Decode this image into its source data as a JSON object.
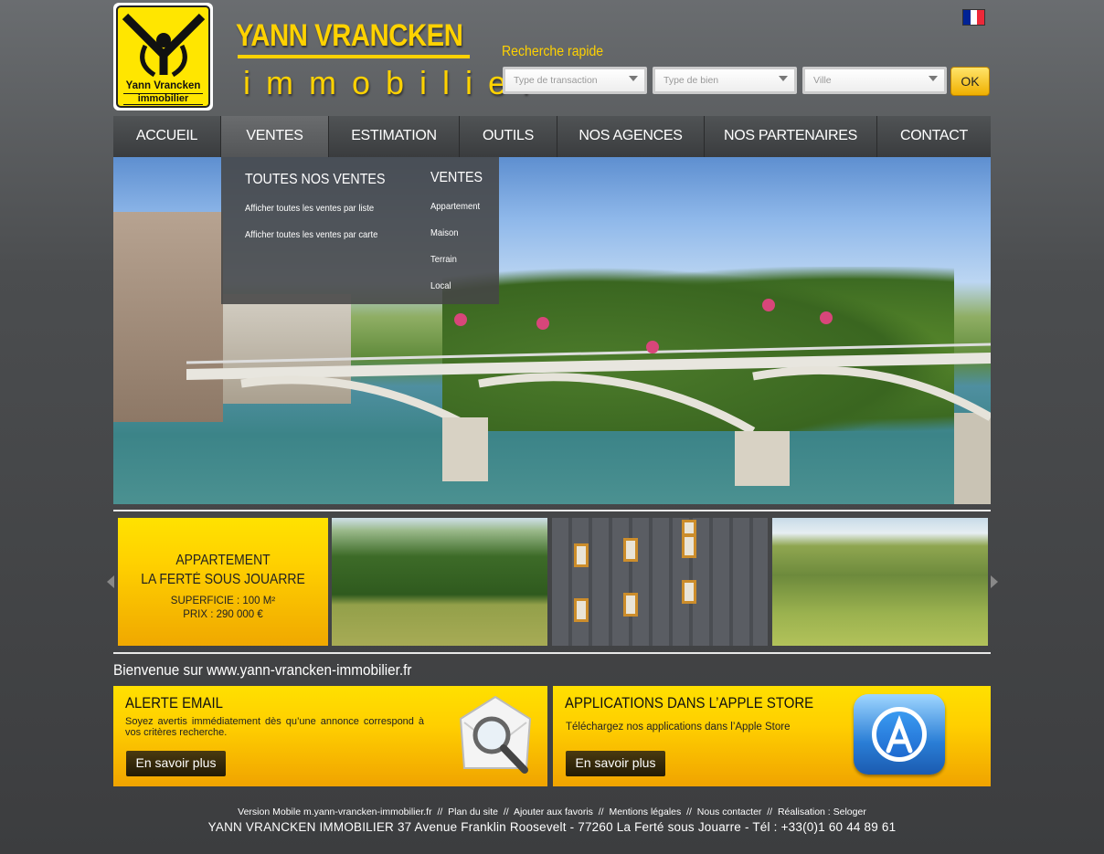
{
  "logo": {
    "line1": "Yann Vrancken",
    "line2": "immobilier"
  },
  "brand": {
    "name": "YANN VRANCKEN",
    "sub": "immobilier"
  },
  "language": {
    "flag_colors": [
      "#002395",
      "#ffffff",
      "#ed2939"
    ]
  },
  "quick_search": {
    "title": "Recherche rapide",
    "transaction_placeholder": "Type de transaction",
    "property_placeholder": "Type de bien",
    "city_placeholder": "Ville",
    "submit_label": "OK"
  },
  "nav": {
    "items": [
      {
        "label": "ACCUEIL"
      },
      {
        "label": "VENTES"
      },
      {
        "label": "ESTIMATION"
      },
      {
        "label": "OUTILS"
      },
      {
        "label": "NOS AGENCES"
      },
      {
        "label": "NOS PARTENAIRES"
      },
      {
        "label": "CONTACT"
      }
    ]
  },
  "dropdown": {
    "left_title": "TOUTES NOS VENTES",
    "left_links": [
      "Afficher toutes les ventes par liste",
      "Afficher toutes les ventes par carte"
    ],
    "right_title": "VENTES",
    "right_links": [
      "Appartement",
      "Maison",
      "Terrain",
      "Local"
    ]
  },
  "featured": {
    "type": "APPARTEMENT",
    "city": "LA FERTÉ SOUS JOUARRE",
    "surface": "SUPERFICIE : 100 M²",
    "price": "PRIX : 290 000 €"
  },
  "welcome": "Bienvenue sur www.yann-vrancken-immobilier.fr",
  "alert_box": {
    "title": "ALERTE EMAIL",
    "description": "Soyez avertis immédiatement dès qu’une annonce correspond à vos critères recherche.",
    "button": "En savoir plus"
  },
  "apps_box": {
    "title": "APPLICATIONS DANS L’APPLE STORE",
    "description": "Téléchargez nos applications dans l’Apple Store",
    "button": "En savoir plus"
  },
  "footer": {
    "links": [
      "Version Mobile m.yann-vrancken-immobilier.fr",
      "Plan du site",
      "Ajouter aux favoris",
      "Mentions légales",
      "Nous contacter",
      "Réalisation : Seloger"
    ],
    "separator": "//",
    "address": "YANN VRANCKEN IMMOBILIER 37 Avenue Franklin Roosevelt - 77260 La Ferté sous Jouarre - Tél : +33(0)1 60 44 89 61"
  }
}
